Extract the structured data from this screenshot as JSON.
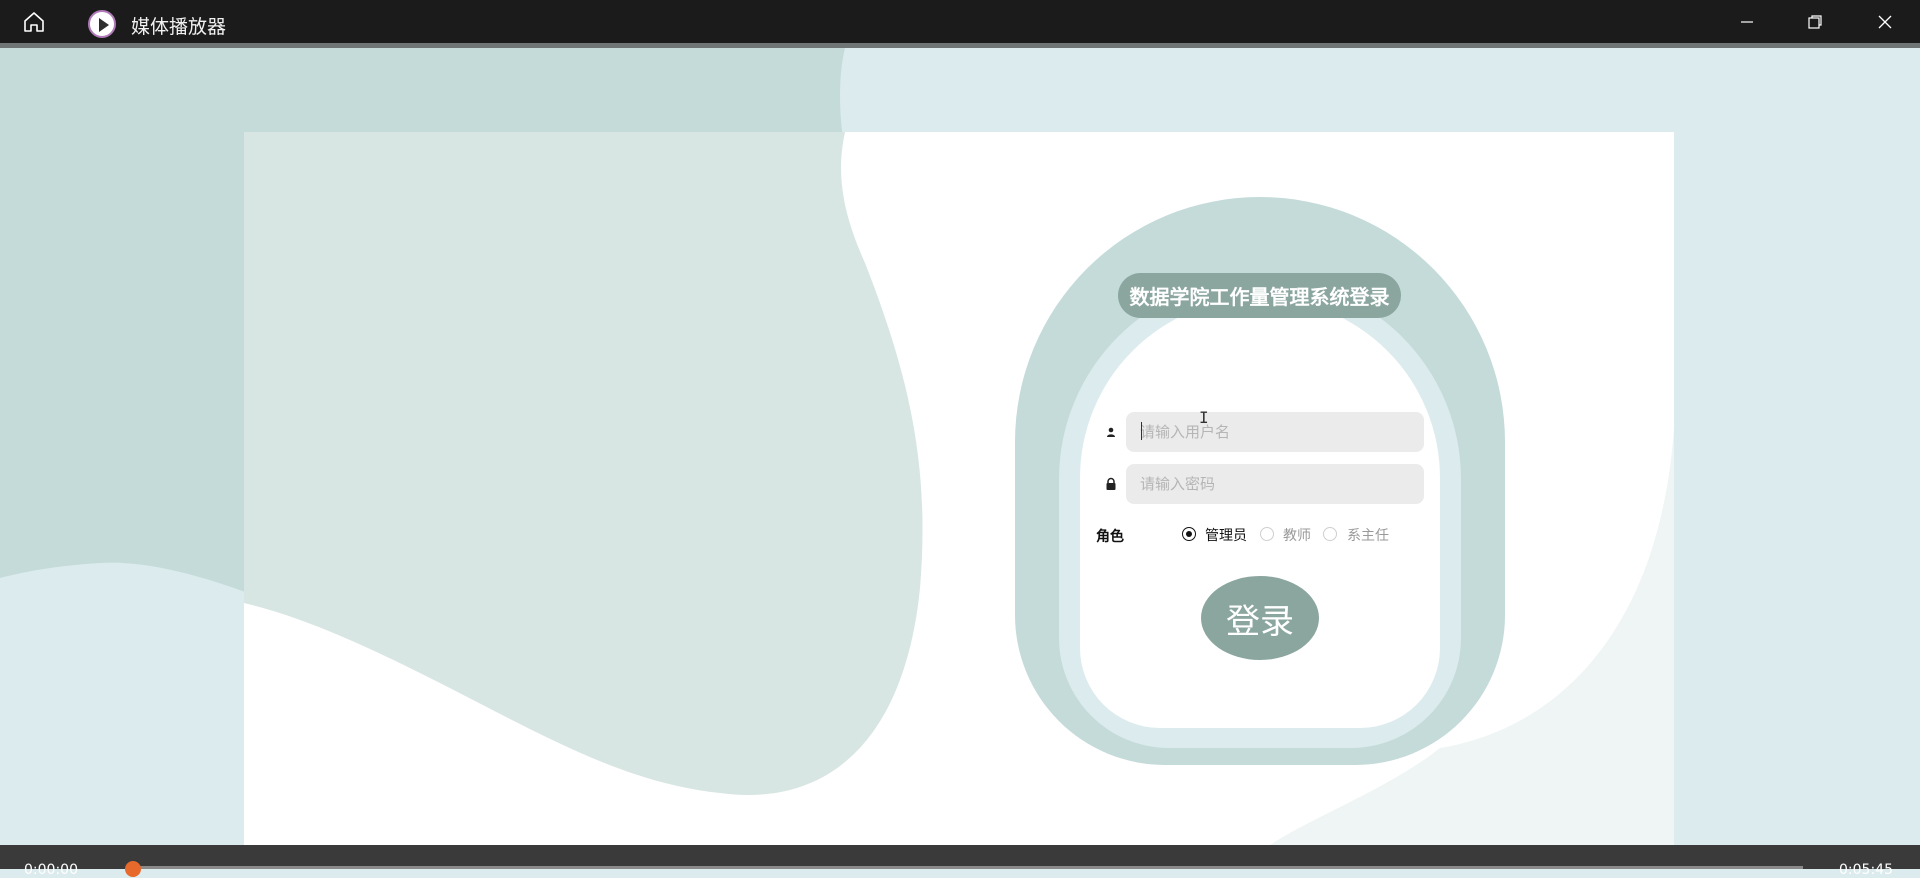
{
  "window": {
    "title": "媒体播放器",
    "icons": {
      "home": "home-icon",
      "app": "play-circle-icon",
      "minimize": "minimize-icon",
      "maximize": "restore-icon",
      "close": "close-icon"
    }
  },
  "login": {
    "title": "数据学院工作量管理系统登录",
    "username_placeholder": "请输入用户名",
    "password_placeholder": "请输入密码",
    "role_label": "角色",
    "roles": [
      {
        "label": "管理员",
        "selected": true
      },
      {
        "label": "教师",
        "selected": false
      },
      {
        "label": "系主任",
        "selected": false
      }
    ],
    "submit_label": "登录",
    "icons": {
      "user": "user-icon",
      "lock": "lock-icon"
    }
  },
  "player": {
    "time_elapsed": "0:00:00",
    "time_total": "0:05:45",
    "progress": 0
  },
  "colors": {
    "accent": "#8ba69f",
    "ring": "#c4dbd9",
    "background": "#dcebed",
    "seek_knob": "#e8692c"
  }
}
